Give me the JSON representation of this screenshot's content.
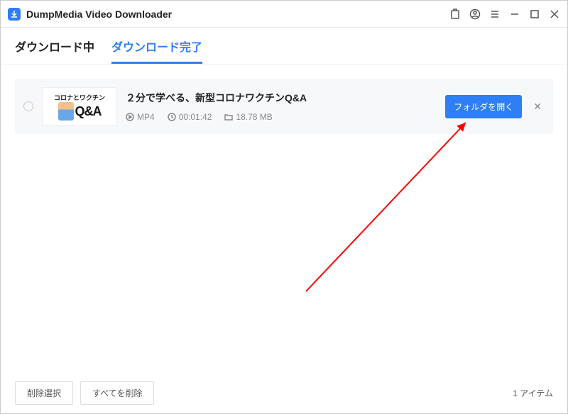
{
  "header": {
    "title": "DumpMedia Video Downloader"
  },
  "tabs": {
    "downloading": "ダウンロード中",
    "completed": "ダウンロード完了"
  },
  "item": {
    "thumb_line1": "コロナとワクチン",
    "thumb_line2": "Q&A",
    "title": "２分で学べる、新型コロナワクチンQ&A",
    "format": "MP4",
    "duration": "00:01:42",
    "size": "18.78 MB",
    "open_folder": "フォルダを開く"
  },
  "footer": {
    "delete_selected": "削除選択",
    "delete_all": "すべてを削除",
    "count": "1 アイテム"
  }
}
